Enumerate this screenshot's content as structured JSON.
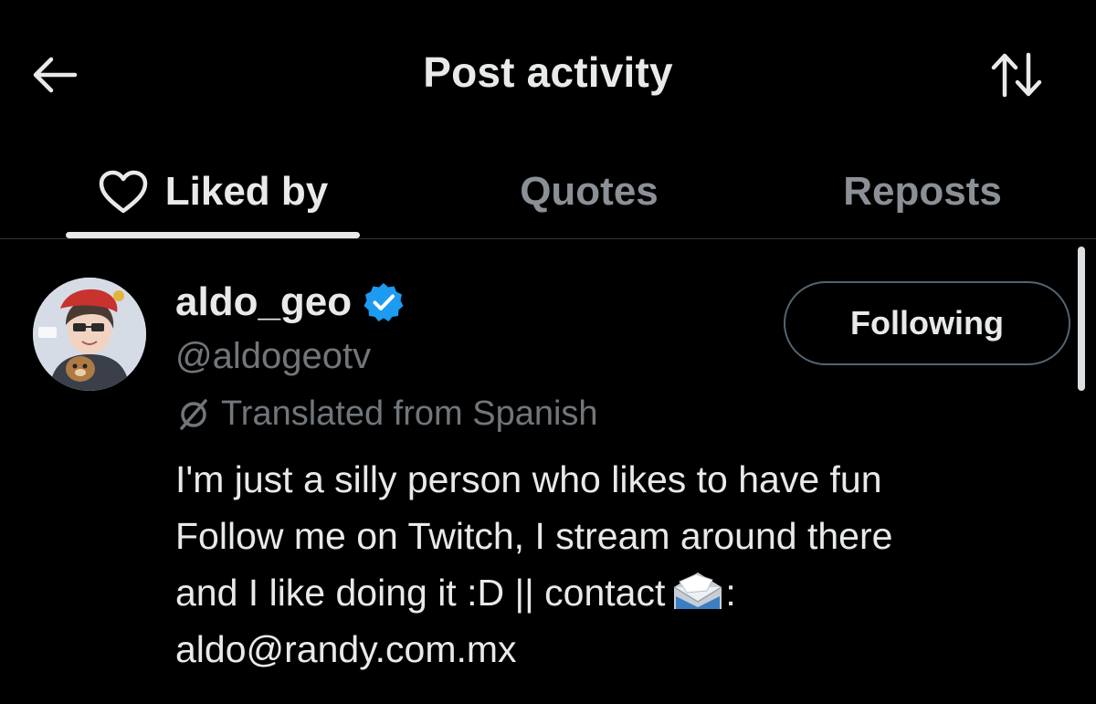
{
  "header": {
    "title": "Post activity",
    "back_icon": "arrow-left-icon",
    "sort_icon": "sort-arrows-icon"
  },
  "tabs": [
    {
      "label": "Liked by",
      "icon": "heart-icon",
      "active": true
    },
    {
      "label": "Quotes",
      "active": false
    },
    {
      "label": "Reposts",
      "active": false
    }
  ],
  "user": {
    "display_name": "aldo_geo",
    "verified": true,
    "handle": "@aldogeotv",
    "follow_button": "Following",
    "translated_label": "Translated from Spanish",
    "bio_lines": [
      "I'm just a silly person who likes to have fun",
      "Follow me on Twitch, I stream around there",
      "and I like doing it :D || contact",
      ":",
      "aldo@randy.com.mx"
    ]
  },
  "colors": {
    "background": "#000000",
    "text_primary": "#e7e9ea",
    "text_secondary": "#71767b",
    "verified_blue": "#1d9bf0",
    "divider": "#2f3336"
  }
}
